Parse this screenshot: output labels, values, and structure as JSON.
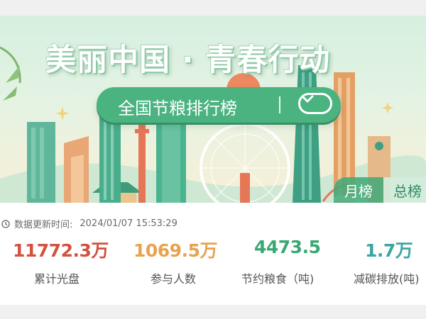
{
  "banner": {
    "title": "美丽中国 · 青春行动",
    "ranking_label": "全国节粮排行榜",
    "tabs": {
      "month": "月榜",
      "total": "总榜"
    }
  },
  "update": {
    "label": "数据更新时间:",
    "time": "2024/01/07 15:53:29"
  },
  "stats": [
    {
      "value": "11772.3万",
      "label": "累计光盘",
      "color": "#d2513f"
    },
    {
      "value": "1069.5万",
      "label": "参与人数",
      "color": "#e8a24e"
    },
    {
      "value": "4473.5",
      "label": "节约粮食（吨)",
      "color": "#3aa873"
    },
    {
      "value": "1.7万",
      "label": "减碳排放(吨)",
      "color": "#3aa6a0"
    }
  ],
  "colors": {
    "accent": "#4ab380",
    "banner_bg": "#d6efdf"
  },
  "icons": {
    "dropdown": "chevron-down-icon",
    "time": "clock-icon"
  }
}
